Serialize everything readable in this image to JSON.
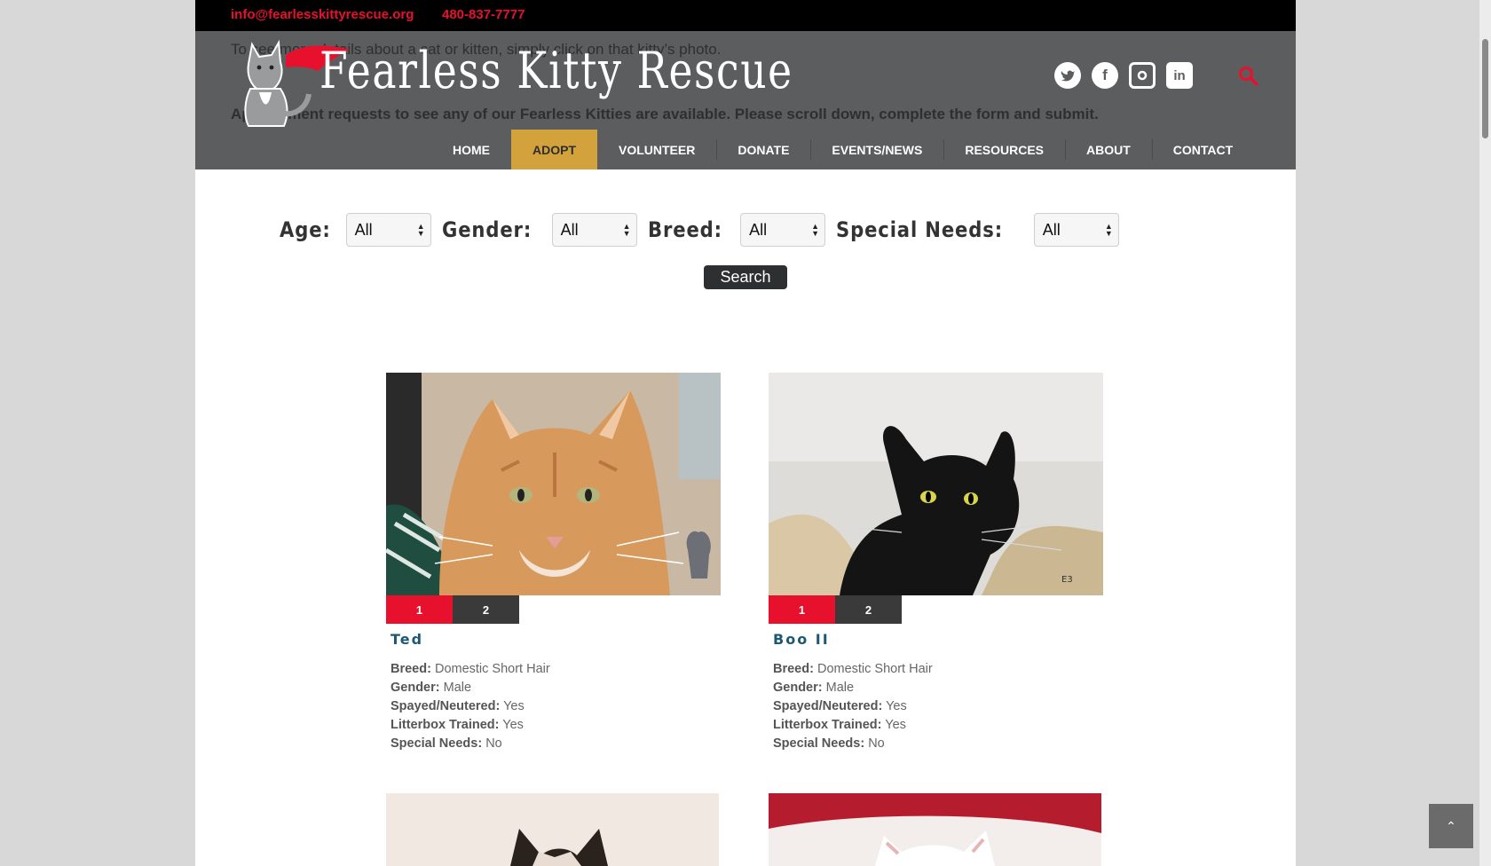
{
  "topbar": {
    "email": "info@fearlesskittyrescue.org",
    "phone": "480-837-7777"
  },
  "header": {
    "site_title": "Fearless Kitty Rescue",
    "ghost_line_1": "To see more details about a cat or kitten, simply click on that kitty’s photo.",
    "ghost_line_2": "Appointment requests to see any of our Fearless Kitties are available.  Please scroll down, complete the form and submit.",
    "social_icons": [
      "twitter-icon",
      "facebook-icon",
      "instagram-icon",
      "linkedin-icon"
    ]
  },
  "nav": {
    "items": [
      {
        "label": "HOME"
      },
      {
        "label": "ADOPT",
        "active": true
      },
      {
        "label": "VOLUNTEER"
      },
      {
        "label": "DONATE"
      },
      {
        "label": "EVENTS/NEWS"
      },
      {
        "label": "RESOURCES"
      },
      {
        "label": "ABOUT"
      },
      {
        "label": "CONTACT"
      }
    ]
  },
  "filters": {
    "age": {
      "label": "Age:",
      "value": "All"
    },
    "gender": {
      "label": "Gender:",
      "value": "All"
    },
    "breed": {
      "label": "Breed:",
      "value": "All"
    },
    "special_needs": {
      "label": "Special Needs:",
      "value": "All"
    },
    "search_label": "Search"
  },
  "cats": [
    {
      "name": "Ted",
      "tabs": [
        "1",
        "2"
      ],
      "breed_label": "Breed:",
      "breed": "Domestic Short Hair",
      "gender_label": "Gender:",
      "gender": "Male",
      "spayed_label": "Spayed/Neutered:",
      "spayed": "Yes",
      "litter_label": "Litterbox Trained:",
      "litter": "Yes",
      "special_label": "Special Needs:",
      "special": "No"
    },
    {
      "name": "Boo II",
      "tabs": [
        "1",
        "2"
      ],
      "breed_label": "Breed:",
      "breed": "Domestic Short Hair",
      "gender_label": "Gender:",
      "gender": "Male",
      "spayed_label": "Spayed/Neutered:",
      "spayed": "Yes",
      "litter_label": "Litterbox Trained:",
      "litter": "Yes",
      "special_label": "Special Needs:",
      "special": "No"
    }
  ],
  "colors": {
    "accent_red": "#e8112d",
    "nav_active": "#d4a23c",
    "header_bg": "#5c5d5f",
    "name_blue": "#1d5873"
  }
}
